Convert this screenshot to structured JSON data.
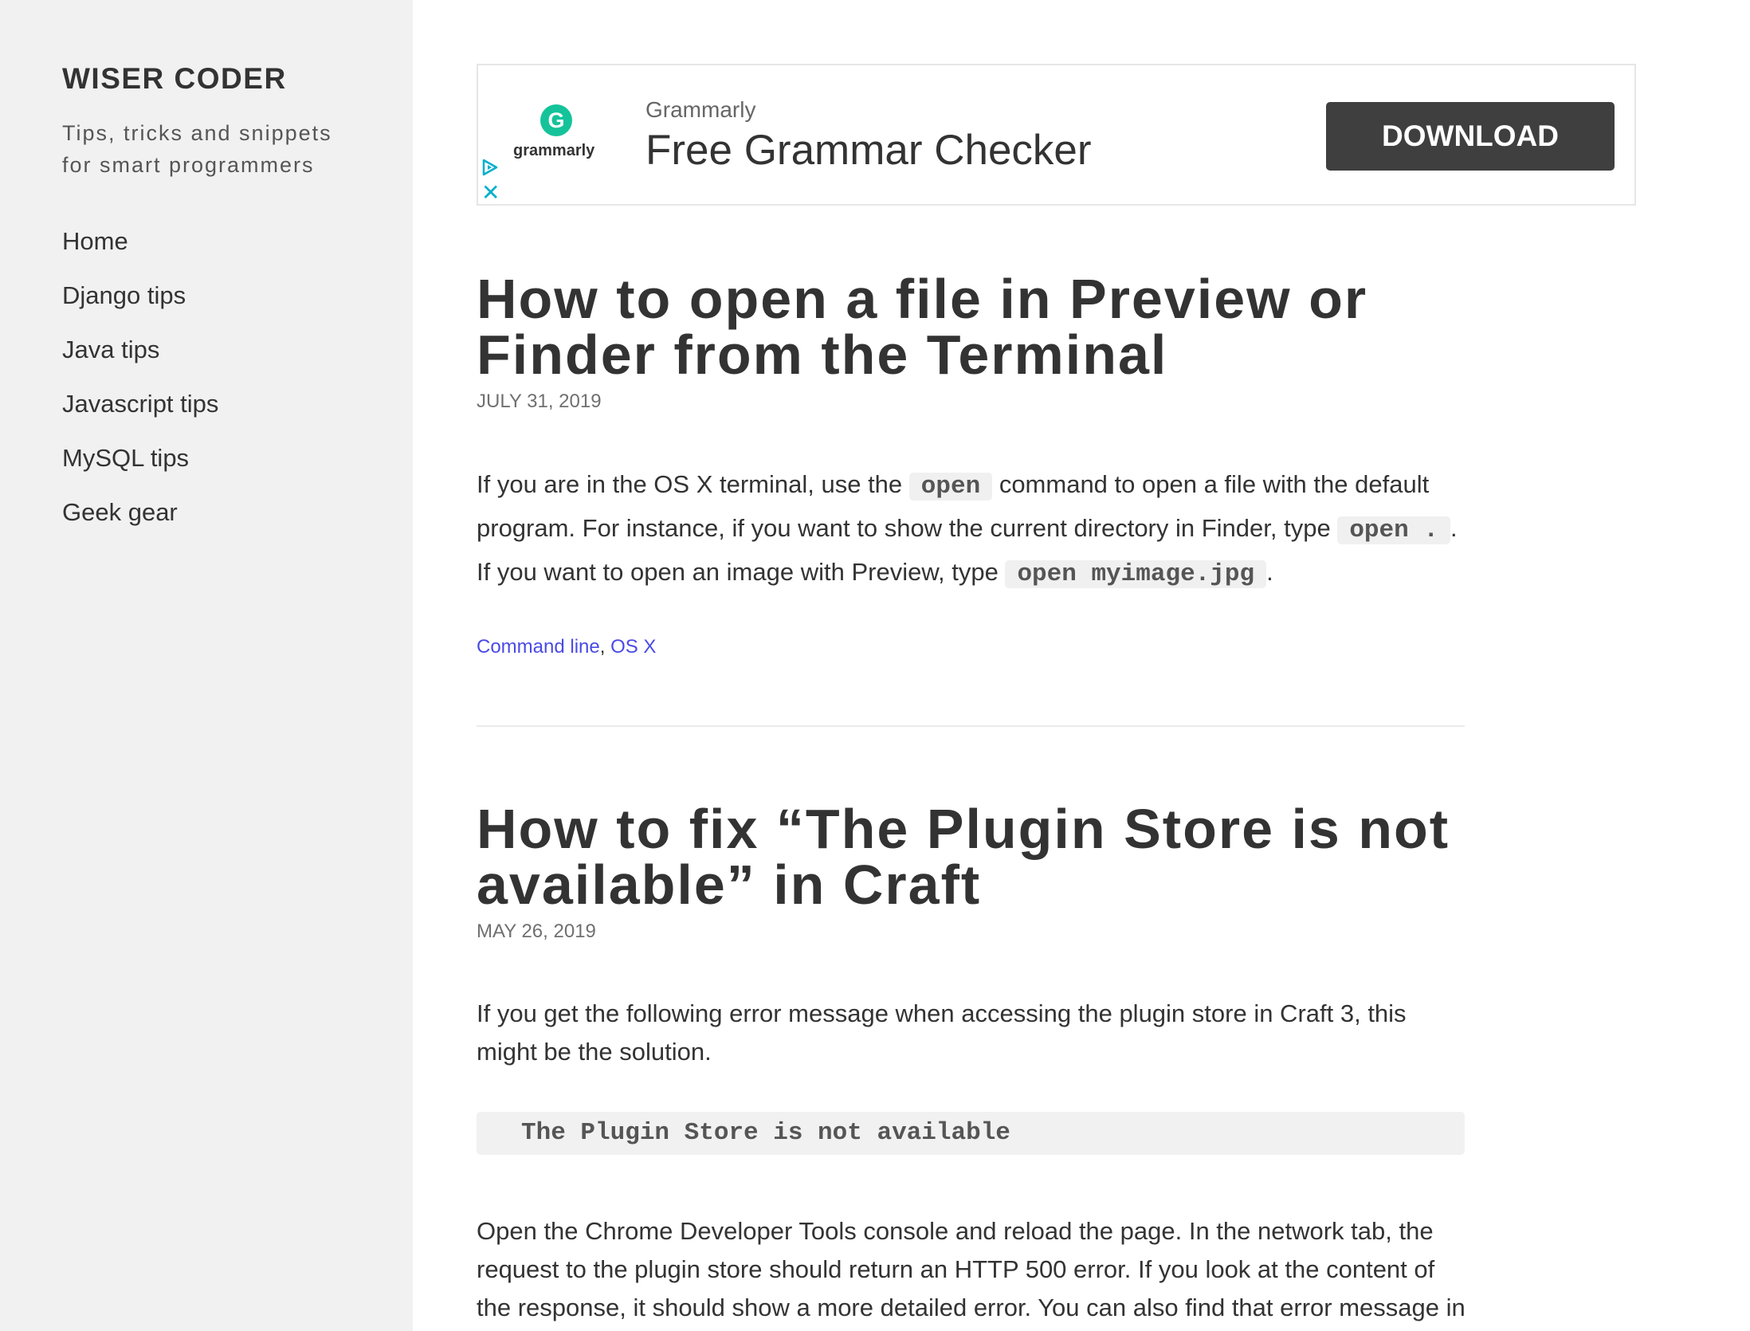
{
  "site": {
    "title": "WISER CODER",
    "description": "Tips, tricks and snippets for smart programmers"
  },
  "nav": {
    "items": [
      "Home",
      "Django tips",
      "Java tips",
      "Javascript tips",
      "MySQL tips",
      "Geek gear"
    ]
  },
  "ad": {
    "logo_letter": "G",
    "logo_text": "grammarly",
    "advertiser": "Grammarly",
    "headline": "Free Grammar Checker",
    "button": "DOWNLOAD",
    "close": "✕",
    "colors": {
      "brand": "#15c39a",
      "choices": "#00aecd",
      "button": "#3f3f3f"
    }
  },
  "posts": [
    {
      "title": "How to open a file in Preview or Finder from the Terminal",
      "date": "JULY 31, 2019",
      "p1": {
        "t1": "If you are in the OS X terminal, use the ",
        "c1": "open",
        "t2": " command to open a file with the default program. For instance, if you want to show the current directory in Finder, type ",
        "c2": "open .",
        "t3": ". If you want to open an image with Preview, type ",
        "c3": "open myimage.jpg",
        "t4": "."
      },
      "tags": [
        "Command line",
        "OS X"
      ],
      "tag_separator": ", "
    },
    {
      "title": "How to fix “The Plugin Store is not available” in Craft",
      "date": "MAY 26, 2019",
      "p1": "If you get the following error message when accessing the plugin store in Craft 3, this might be the solution.",
      "code": "The Plugin Store is not available",
      "p2": "Open the Chrome Developer Tools console and reload the page. In the network tab, the request to the plugin store should return an HTTP 500 error. If you look at the content of the response, it should show a more detailed error. You can also find that error message in"
    }
  ]
}
